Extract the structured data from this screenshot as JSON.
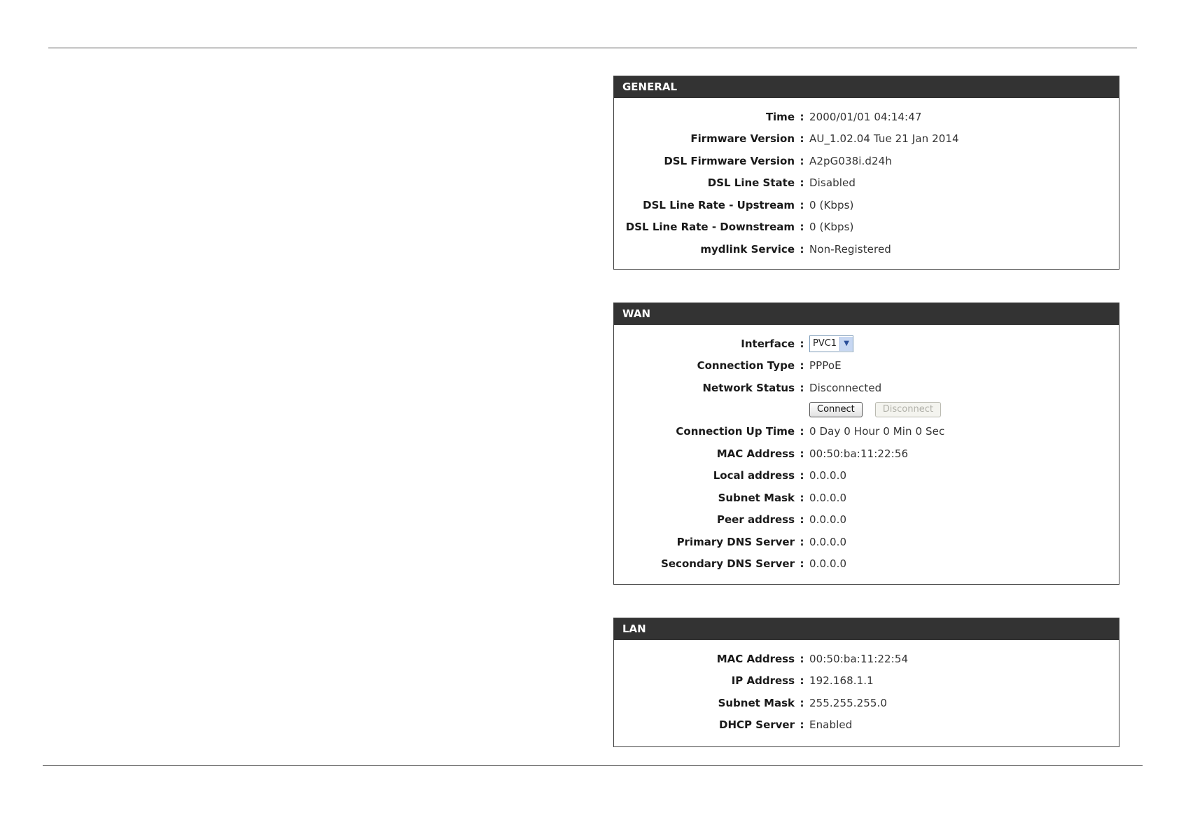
{
  "general": {
    "title": "GENERAL",
    "rows": [
      {
        "label": "Time",
        "value": "2000/01/01 04:14:47"
      },
      {
        "label": "Firmware Version",
        "value": "AU_1.02.04 Tue 21 Jan 2014"
      },
      {
        "label": "DSL Firmware Version",
        "value": "A2pG038i.d24h"
      },
      {
        "label": "DSL Line State",
        "value": "Disabled"
      },
      {
        "label": "DSL Line Rate - Upstream",
        "value": "0  (Kbps)"
      },
      {
        "label": "DSL Line Rate - Downstream",
        "value": "0  (Kbps)"
      },
      {
        "label": "mydlink Service",
        "value": "Non-Registered"
      }
    ]
  },
  "wan": {
    "title": "WAN",
    "interface": {
      "label": "Interface",
      "selected": "PVC1"
    },
    "connection_type": {
      "label": "Connection Type",
      "value": "PPPoE"
    },
    "network_status": {
      "label": "Network Status",
      "value": "Disconnected"
    },
    "connect_label": "Connect",
    "disconnect_label": "Disconnect",
    "rows": [
      {
        "label": "Connection Up Time",
        "value": "0 Day 0 Hour 0 Min 0 Sec"
      },
      {
        "label": "MAC Address",
        "value": "00:50:ba:11:22:56"
      },
      {
        "label": "Local address",
        "value": "0.0.0.0"
      },
      {
        "label": "Subnet Mask",
        "value": "0.0.0.0"
      },
      {
        "label": "Peer address",
        "value": "0.0.0.0"
      },
      {
        "label": "Primary DNS Server",
        "value": "0.0.0.0"
      },
      {
        "label": "Secondary DNS Server",
        "value": "0.0.0.0"
      }
    ]
  },
  "lan": {
    "title": "LAN",
    "rows": [
      {
        "label": "MAC Address",
        "value": "00:50:ba:11:22:54"
      },
      {
        "label": "IP Address",
        "value": "192.168.1.1"
      },
      {
        "label": "Subnet Mask",
        "value": "255.255.255.0"
      },
      {
        "label": "DHCP Server",
        "value": "Enabled"
      }
    ]
  },
  "separator": ":"
}
